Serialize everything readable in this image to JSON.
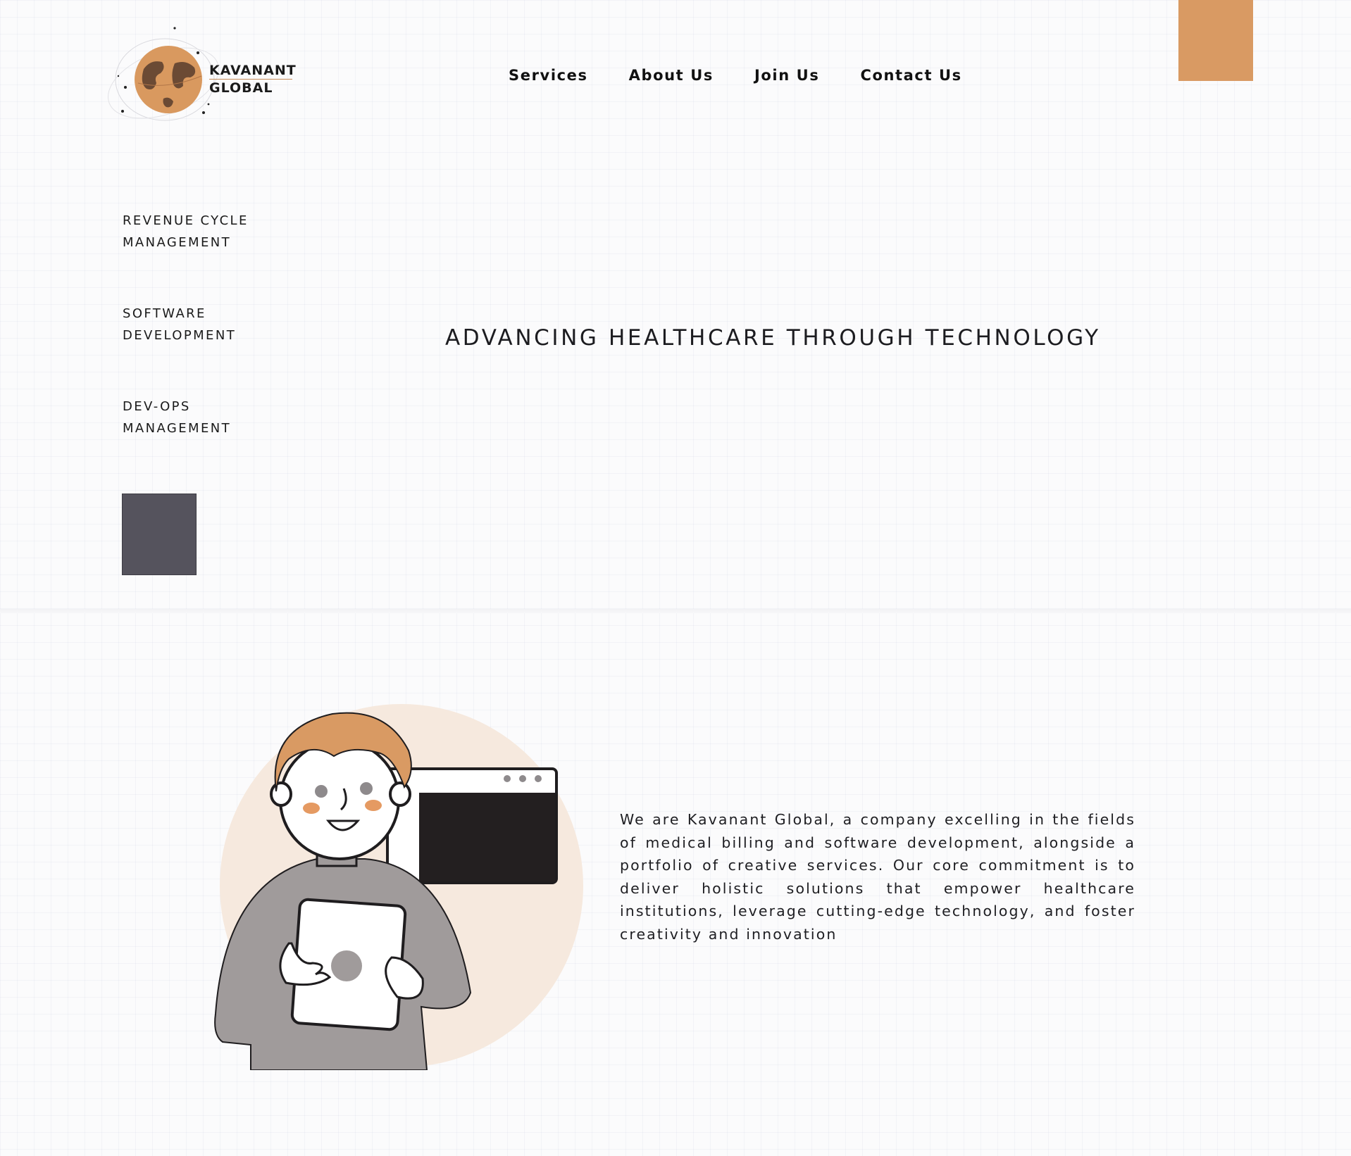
{
  "brand": {
    "name_line1": "KAVANANT",
    "name_line2": "GLOBAL"
  },
  "nav": {
    "items": [
      "Services",
      "About Us",
      "Join Us",
      "Contact Us"
    ]
  },
  "services": [
    {
      "line1": "REVENUE CYCLE",
      "line2": "MANAGEMENT"
    },
    {
      "line1": "SOFTWARE",
      "line2": "DEVELOPMENT"
    },
    {
      "line1": "DEV-OPS",
      "line2": "MANAGEMENT"
    }
  ],
  "hero": {
    "title": "ADVANCING HEALTHCARE THROUGH TECHNOLOGY"
  },
  "about": {
    "text": "We are Kavanant Global, a company excelling in the fields of medical billing and software development, alongside a portfolio of creative services. Our core commitment is to deliver holistic solutions that empower healthcare institutions, leverage cutting-edge technology, and foster creativity and innovation"
  },
  "colors": {
    "accent": "#d99a63",
    "dark": "#55535d",
    "background": "#fbfbfc"
  }
}
